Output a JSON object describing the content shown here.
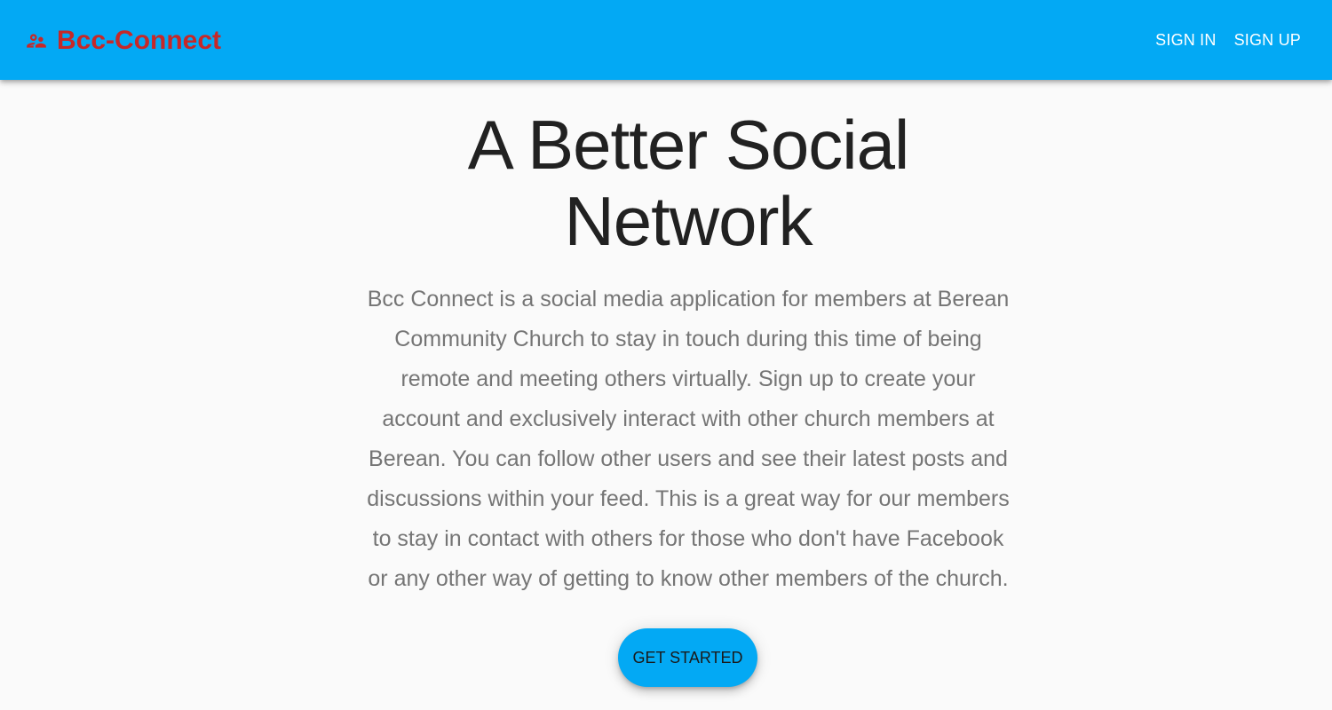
{
  "appbar": {
    "brand_icon": "group-people-icon",
    "brand_title": "Bcc-Connect",
    "nav": [
      {
        "label": "SIGN IN"
      },
      {
        "label": "SIGN UP"
      }
    ],
    "background_color": "#03a9f4",
    "brand_color": "#c62828"
  },
  "hero": {
    "headline": "A Better Social Network",
    "description": "Bcc Connect is a social media application for members at Berean Community Church to stay in touch during this time of being remote and meeting others virtually. Sign up to create your account and exclusively interact with other church members at Berean. You can follow other users and see their latest posts and discussions within your feed. This is a great way for our members to stay in contact with others for those who don't have Facebook or any other way of getting to know other members of the church.",
    "cta_label": "GET STARTED"
  }
}
